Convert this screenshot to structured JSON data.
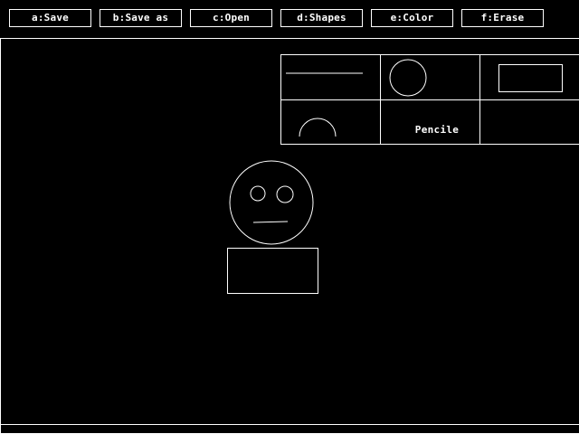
{
  "toolbar": {
    "buttons": [
      {
        "label": "a:Save"
      },
      {
        "label": "b:Save as"
      },
      {
        "label": "c:Open"
      },
      {
        "label": "d:Shapes"
      },
      {
        "label": "e:Color"
      },
      {
        "label": "f:Erase"
      }
    ]
  },
  "shapes_panel": {
    "tools": [
      {
        "icon": "line-icon"
      },
      {
        "icon": "circle-icon"
      },
      {
        "icon": "rectangle-icon"
      },
      {
        "icon": "arc-icon"
      },
      {
        "label": "Pencile"
      },
      {
        "icon": "empty-slot"
      }
    ]
  },
  "colors": {
    "background": "#000000",
    "foreground": "#ffffff"
  }
}
